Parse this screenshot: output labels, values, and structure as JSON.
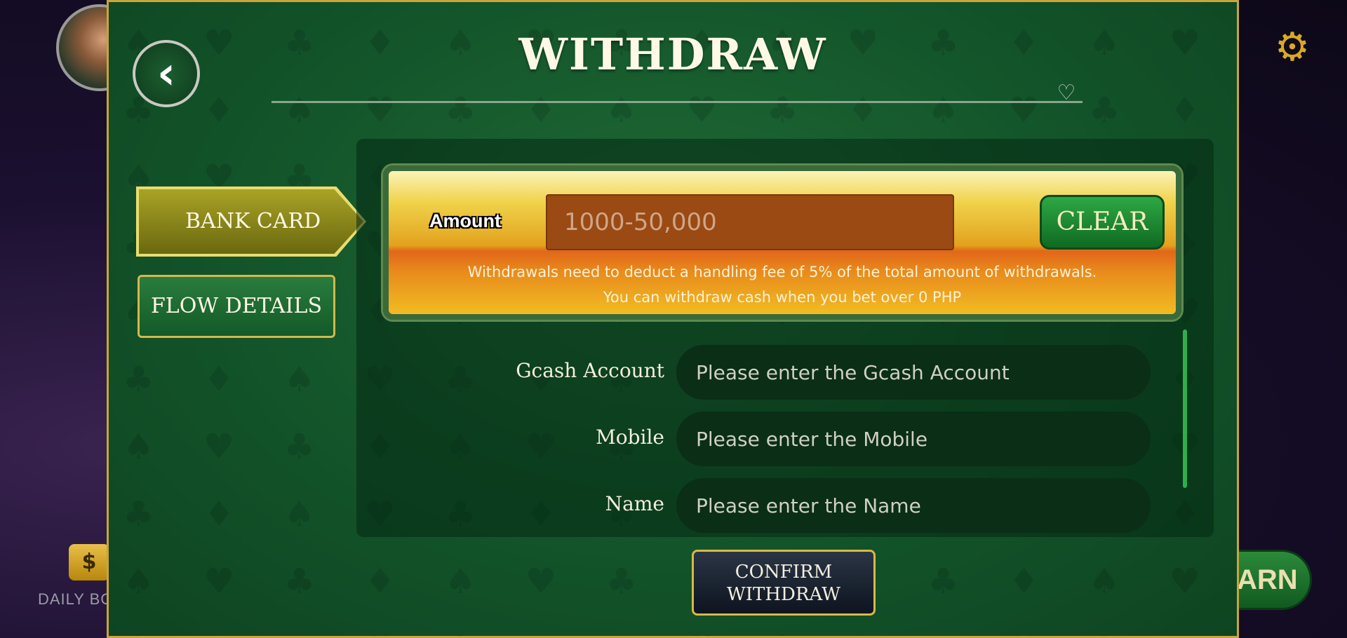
{
  "background": {
    "daily_label": "DAILY BO",
    "earn_label": "ARN",
    "daily_icon_glyph": "$"
  },
  "header": {
    "title": "WITHDRAW",
    "back_glyph": "‹"
  },
  "tabs": [
    {
      "label": "BANK CARD",
      "active": true
    },
    {
      "label": "FLOW DETAILS",
      "active": false
    }
  ],
  "amount": {
    "label": "Amount",
    "placeholder": "1000-50,000",
    "clear_label": "CLEAR",
    "note_line1": "Withdrawals need to deduct a handling fee of 5% of the total amount of withdrawals.",
    "note_line2": "You can withdraw cash when you bet over 0 PHP"
  },
  "form": {
    "fields": [
      {
        "label": "Gcash Account",
        "placeholder": "Please enter the Gcash Account"
      },
      {
        "label": "Mobile",
        "placeholder": "Please enter the Mobile"
      },
      {
        "label": "Name",
        "placeholder": "Please enter the Name"
      }
    ]
  },
  "confirm": {
    "line1": "CONFIRM",
    "line2": "WITHDRAW"
  },
  "colors": {
    "modal_green": "#13542a",
    "gold_border": "#c9a53c",
    "clear_green": "#2ea844",
    "amount_input_bg": "#9a4a12"
  },
  "icons": [
    "avatar",
    "gear-icon",
    "back-arrow-icon",
    "heart-icon",
    "daily-bonus-icon"
  ]
}
